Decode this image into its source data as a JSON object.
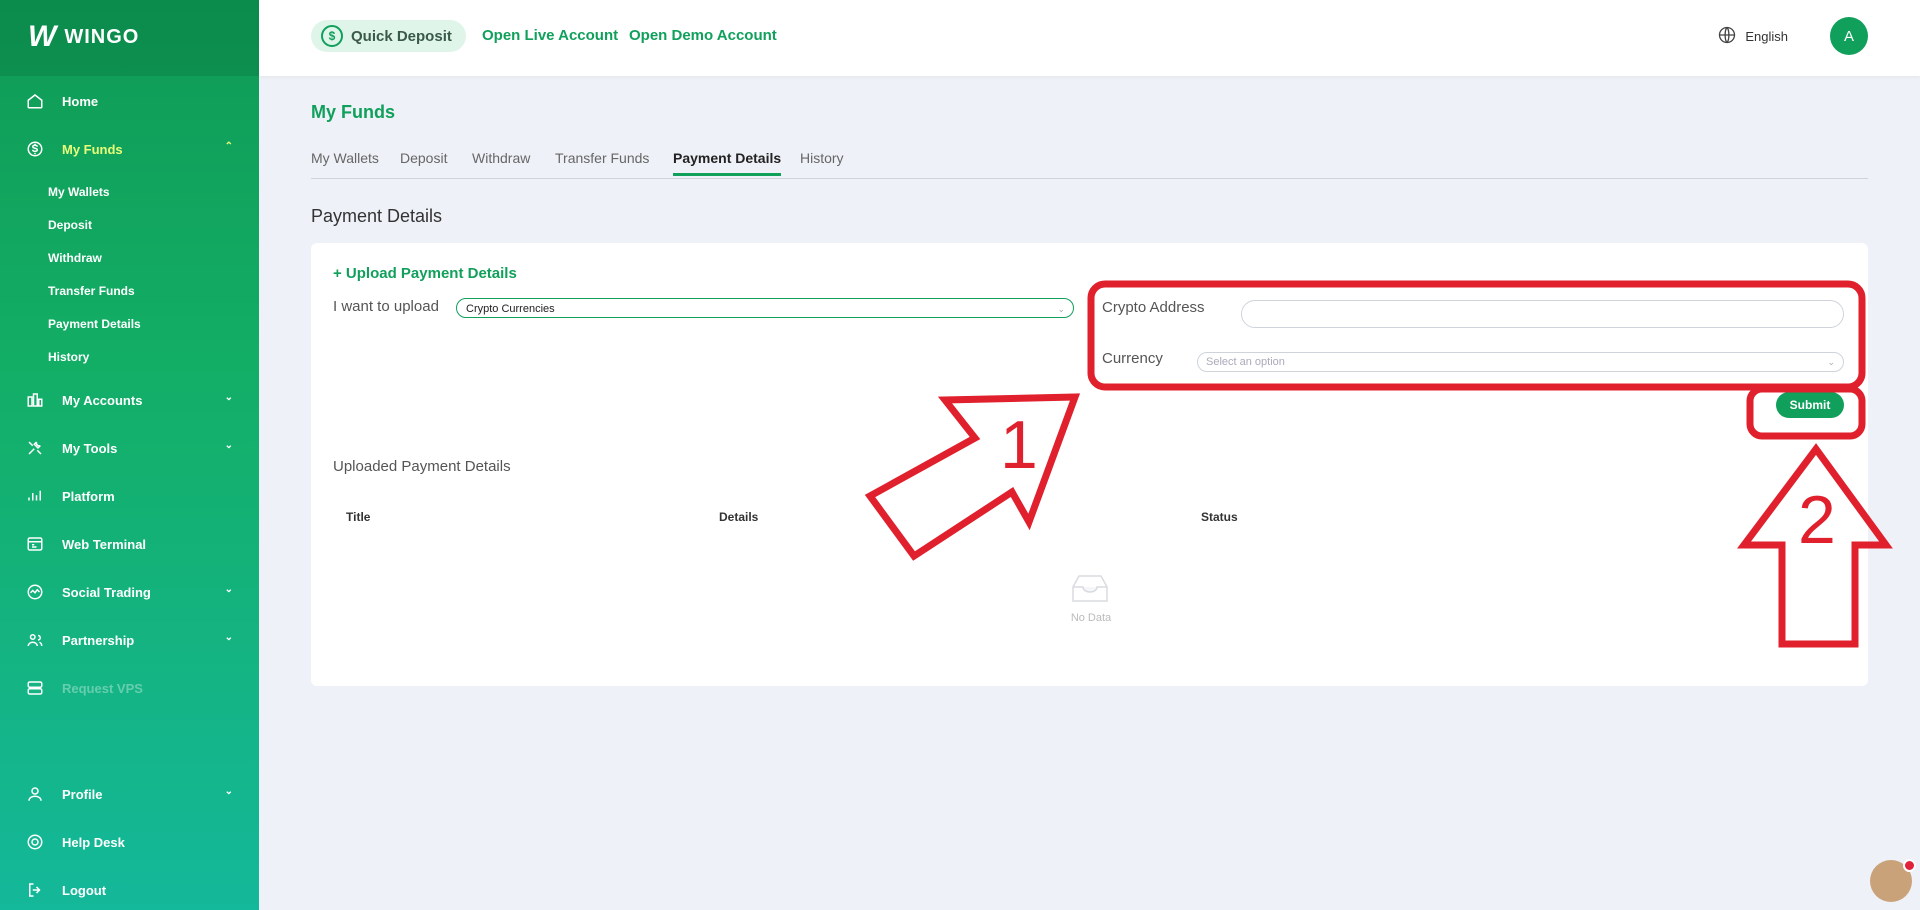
{
  "brand": {
    "name": "WINGO",
    "mark": "W"
  },
  "sidebar": {
    "items": [
      {
        "label": "Home",
        "icon": "home-icon"
      },
      {
        "label": "My Funds",
        "icon": "dollar-circle-icon"
      },
      {
        "label": "My Accounts",
        "icon": "accounts-icon"
      },
      {
        "label": "My Tools",
        "icon": "tools-icon"
      },
      {
        "label": "Platform",
        "icon": "platform-icon"
      },
      {
        "label": "Web Terminal",
        "icon": "terminal-icon"
      },
      {
        "label": "Social Trading",
        "icon": "social-trading-icon"
      },
      {
        "label": "Partnership",
        "icon": "partnership-icon"
      },
      {
        "label": "Request VPS",
        "icon": "server-icon"
      },
      {
        "label": "Profile",
        "icon": "user-icon"
      },
      {
        "label": "Help Desk",
        "icon": "lifebuoy-icon"
      },
      {
        "label": "Logout",
        "icon": "logout-icon"
      }
    ],
    "funds_sub": [
      "My Wallets",
      "Deposit",
      "Withdraw",
      "Transfer Funds",
      "Payment Details",
      "History"
    ]
  },
  "topbar": {
    "quick_deposit": "Quick Deposit",
    "open_live": "Open Live Account",
    "open_demo": "Open Demo Account",
    "language": "English",
    "avatar_initial": "A"
  },
  "main": {
    "page_title": "My Funds",
    "tabs": [
      "My Wallets",
      "Deposit",
      "Withdraw",
      "Transfer Funds",
      "Payment Details",
      "History"
    ],
    "active_tab": "Payment Details",
    "section_title": "Payment Details",
    "upload_link": "+ Upload Payment Details",
    "upload_label": "I want to upload",
    "upload_value": "Crypto Currencies",
    "crypto_address_label": "Crypto Address",
    "crypto_address_value": "",
    "currency_label": "Currency",
    "currency_placeholder": "Select an option",
    "submit_label": "Submit",
    "uploaded_title": "Uploaded Payment Details",
    "table_headers": [
      "Title",
      "Details",
      "Status"
    ],
    "empty_text": "No Data"
  },
  "annotations": {
    "labels": [
      "1",
      "2"
    ],
    "color": "#e0202c"
  },
  "colors": {
    "accent": "#11a05c",
    "sidebar_start": "#0f9a55",
    "sidebar_end": "#14b89a",
    "background": "#eef1f7"
  }
}
